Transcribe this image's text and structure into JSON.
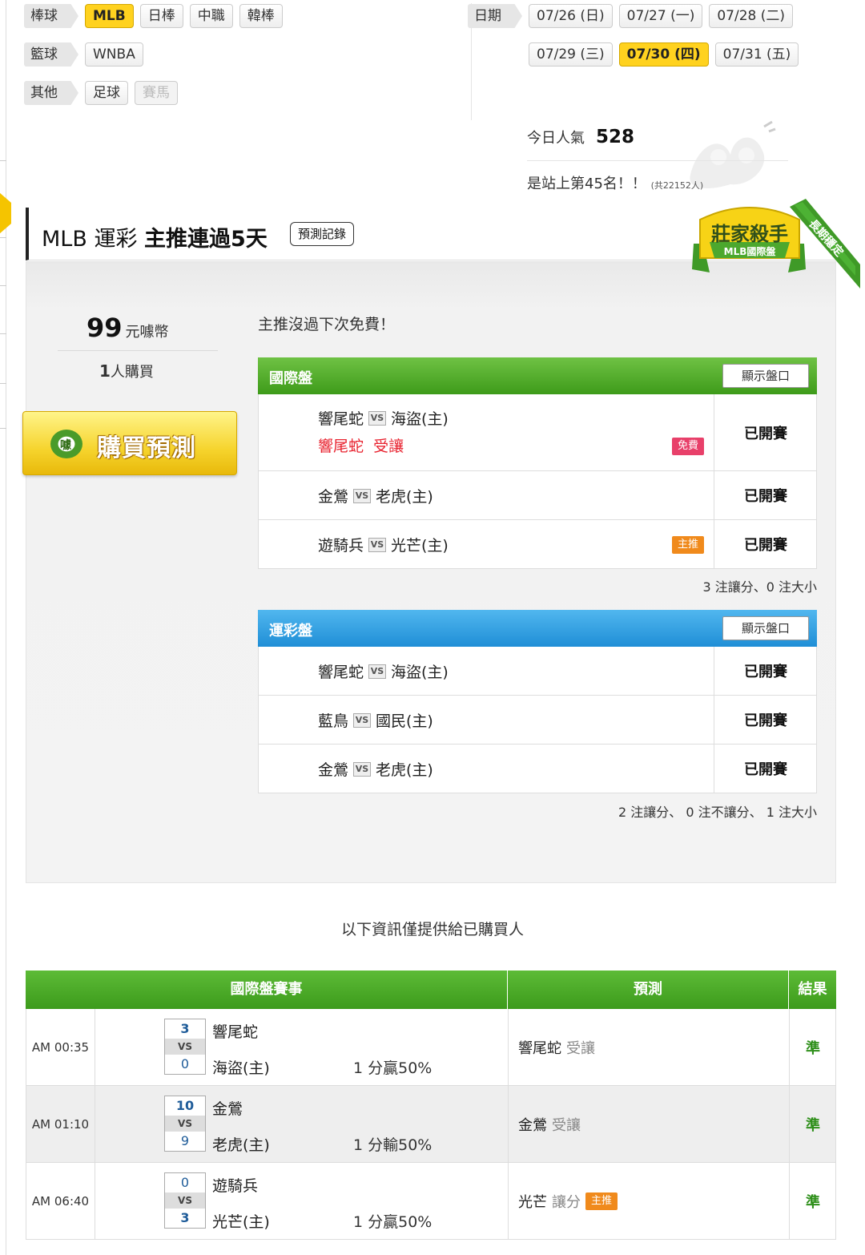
{
  "filters": {
    "rows": [
      {
        "category": "棒球",
        "items": [
          {
            "label": "MLB",
            "state": "active"
          },
          {
            "label": "日棒",
            "state": "normal"
          },
          {
            "label": "中職",
            "state": "normal"
          },
          {
            "label": "韓棒",
            "state": "normal"
          }
        ]
      },
      {
        "category": "籃球",
        "items": [
          {
            "label": "WNBA",
            "state": "normal"
          }
        ]
      },
      {
        "category": "其他",
        "items": [
          {
            "label": "足球",
            "state": "normal"
          },
          {
            "label": "賽馬",
            "state": "disabled"
          }
        ]
      }
    ],
    "date_label": "日期",
    "dates_row1": [
      "07/26 (日)",
      "07/27 (一)",
      "07/28 (二)"
    ],
    "dates_row2": [
      "07/29 (三)",
      "07/30 (四)",
      "07/31 (五)"
    ],
    "active_date": "07/30 (四)"
  },
  "stats": {
    "popularity_label": "今日人氣",
    "popularity_value": "528",
    "rank_text": "是站上第45名！！",
    "rank_total": "(共22152人)"
  },
  "header": {
    "title_prefix": "MLB 運彩",
    "title_main": "主推連過5天",
    "record_button": "預測記錄",
    "badge_title": "莊家殺手",
    "badge_sub": "MLB國際盤",
    "badge_ribbon": "長期穩定"
  },
  "purchase": {
    "price": "99",
    "currency": "元噱幣",
    "buyers_count": "1",
    "buyers_label": "人購買",
    "buy_button": "購買預測",
    "logo_text": "噱",
    "notice": "主推沒過下次免費！"
  },
  "intl": {
    "title": "國際盤",
    "show_button": "顯示盤口",
    "rows": [
      {
        "away": "響尾蛇",
        "home": "海盜(主)",
        "pick_team": "響尾蛇",
        "pick_type": "受讓",
        "tag": "免費",
        "status": "已開賽"
      },
      {
        "away": "金鶯",
        "home": "老虎(主)",
        "status": "已開賽"
      },
      {
        "away": "遊騎兵",
        "home": "光芒(主)",
        "tag": "主推",
        "status": "已開賽"
      }
    ],
    "summary": "3 注讓分、0 注大小"
  },
  "lottery": {
    "title": "運彩盤",
    "show_button": "顯示盤口",
    "rows": [
      {
        "away": "響尾蛇",
        "home": "海盜(主)",
        "status": "已開賽"
      },
      {
        "away": "藍鳥",
        "home": "國民(主)",
        "status": "已開賽"
      },
      {
        "away": "金鶯",
        "home": "老虎(主)",
        "status": "已開賽"
      }
    ],
    "summary": "2 注讓分、 0 注不讓分、 1 注大小"
  },
  "vs_label": "VS",
  "info_text": "以下資訊僅提供給已購買人",
  "results": {
    "headers": [
      "國際盤賽事",
      "預測",
      "結果"
    ],
    "rows": [
      {
        "time": "AM 00:35",
        "score1": "3",
        "score2": "0",
        "team1": "響尾蛇",
        "team2": "海盜(主)",
        "outcome": "1 分贏50%",
        "pred_team": "響尾蛇",
        "pred_type": "受讓",
        "result": "準"
      },
      {
        "time": "AM 01:10",
        "score1": "10",
        "score2": "9",
        "team1": "金鶯",
        "team2": "老虎(主)",
        "outcome": "1 分輸50%",
        "pred_team": "金鶯",
        "pred_type": "受讓",
        "result": "準"
      },
      {
        "time": "AM 06:40",
        "score1": "0",
        "score2": "3",
        "team1": "遊騎兵",
        "team2": "光芒(主)",
        "outcome": "1 分贏50%",
        "pred_team": "光芒",
        "pred_type": "讓分",
        "pred_tag": "主推",
        "result": "準"
      }
    ]
  }
}
